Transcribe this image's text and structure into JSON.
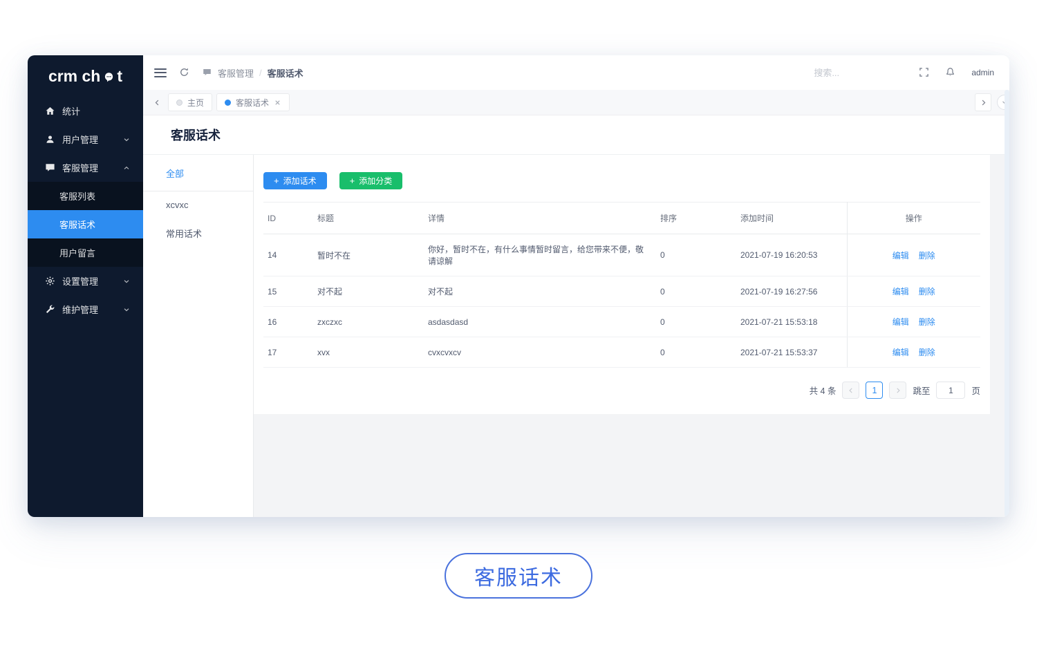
{
  "colors": {
    "accent": "#2d8cf0",
    "green": "#19be6b",
    "sidebar_bg": "#0e1a2e",
    "submenu_bg": "#09121f",
    "caption_blue": "#3d6be0"
  },
  "sidebar": {
    "logo": {
      "text_left": "crm ch",
      "text_right": "t",
      "icon": "chat-bubble"
    },
    "items": [
      {
        "label": "统计",
        "icon": "home-icon"
      },
      {
        "label": "用户管理",
        "icon": "user-icon",
        "chevron": "down"
      },
      {
        "label": "客服管理",
        "icon": "chat-icon",
        "chevron": "up"
      },
      {
        "label": "设置管理",
        "icon": "gear-icon",
        "chevron": "down"
      },
      {
        "label": "维护管理",
        "icon": "wrench-icon",
        "chevron": "down"
      }
    ],
    "submenu": [
      {
        "label": "客服列表",
        "active": false
      },
      {
        "label": "客服话术",
        "active": true
      },
      {
        "label": "用户留言",
        "active": false
      }
    ]
  },
  "navbar": {
    "breadcrumb": {
      "parent": "客服管理",
      "separator": "/",
      "current": "客服话术"
    },
    "search_placeholder": "搜索...",
    "username": "admin"
  },
  "tabbar": {
    "tabs": [
      {
        "label": "主页",
        "dot": "gray",
        "closable": false
      },
      {
        "label": "客服话术",
        "dot": "blue",
        "closable": true
      }
    ]
  },
  "page": {
    "title": "客服话术"
  },
  "categories": [
    {
      "label": "全部",
      "active": true
    },
    {
      "label": "xcvxc",
      "active": false
    },
    {
      "label": "常用话术",
      "active": false
    }
  ],
  "toolbar": {
    "add_script_label": "添加话术",
    "add_category_label": "添加分类",
    "plus": "+"
  },
  "table": {
    "columns": {
      "id": "ID",
      "title": "标题",
      "detail": "详情",
      "sort": "排序",
      "time": "添加时间",
      "op": "操作"
    },
    "actions": {
      "edit": "编辑",
      "delete": "删除"
    },
    "rows": [
      {
        "id": "14",
        "title": "暂时不在",
        "detail": "你好，暂时不在，有什么事情暂时留言，给您带来不便，敬请谅解",
        "sort": "0",
        "time": "2021-07-19 16:20:53"
      },
      {
        "id": "15",
        "title": "对不起",
        "detail": "对不起",
        "sort": "0",
        "time": "2021-07-19 16:27:56"
      },
      {
        "id": "16",
        "title": "zxczxc",
        "detail": "asdasdasd",
        "sort": "0",
        "time": "2021-07-21 15:53:18"
      },
      {
        "id": "17",
        "title": "xvx",
        "detail": "cvxcvxcv",
        "sort": "0",
        "time": "2021-07-21 15:53:37"
      }
    ]
  },
  "pagination": {
    "total": "共 4 条",
    "current_page": "1",
    "jump_label": "跳至",
    "jump_value": "1",
    "page_unit": "页"
  },
  "caption": {
    "label": "客服话术"
  }
}
